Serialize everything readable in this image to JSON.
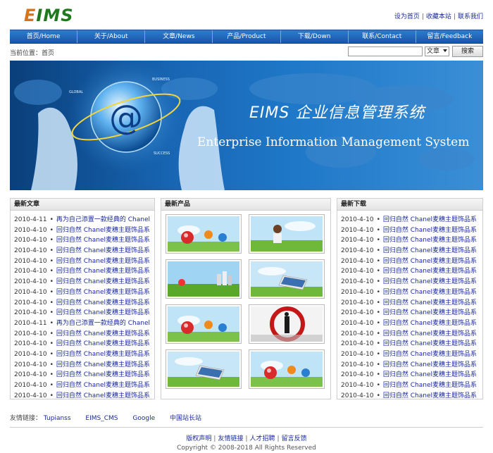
{
  "header": {
    "logo_e": "E",
    "logo_rest": "IMS",
    "top_links": [
      "设为首页",
      "收藏本站",
      "联系我们"
    ]
  },
  "nav": [
    "首页/Home",
    "关于/About",
    "文章/News",
    "产品/Product",
    "下载/Down",
    "联系/Contact",
    "留言/Feedback"
  ],
  "location": "当前位置：首页",
  "search": {
    "select_value": "文章",
    "button_label": "搜索",
    "input_value": ""
  },
  "banner": {
    "title": "EIMS   企业信息管理系统",
    "subtitle": "Enterprise Information Management System",
    "globe_labels": [
      "GLOBAL",
      "BUSINESS",
      "SUCCESS"
    ],
    "globe_symbol": "@"
  },
  "articles": {
    "heading": "最新文章",
    "items": [
      {
        "date": "2010-4-11",
        "title": "再为自己添置一款经典的 Chanel"
      },
      {
        "date": "2010-4-10",
        "title": "回归自然 Chanel麦穗主题饰品系"
      },
      {
        "date": "2010-4-10",
        "title": "回归自然 Chanel麦穗主题饰品系"
      },
      {
        "date": "2010-4-10",
        "title": "回归自然 Chanel麦穗主题饰品系"
      },
      {
        "date": "2010-4-10",
        "title": "回归自然 Chanel麦穗主题饰品系"
      },
      {
        "date": "2010-4-10",
        "title": "回归自然 Chanel麦穗主题饰品系"
      },
      {
        "date": "2010-4-10",
        "title": "回归自然 Chanel麦穗主题饰品系"
      },
      {
        "date": "2010-4-10",
        "title": "回归自然 Chanel麦穗主题饰品系"
      },
      {
        "date": "2010-4-10",
        "title": "回归自然 Chanel麦穗主题饰品系"
      },
      {
        "date": "2010-4-10",
        "title": "回归自然 Chanel麦穗主题饰品系"
      },
      {
        "date": "2010-4-11",
        "title": "再为自己添置一款经典的 Chanel"
      },
      {
        "date": "2010-4-10",
        "title": "回归自然 Chanel麦穗主题饰品系"
      },
      {
        "date": "2010-4-10",
        "title": "回归自然 Chanel麦穗主题饰品系"
      },
      {
        "date": "2010-4-10",
        "title": "回归自然 Chanel麦穗主题饰品系"
      },
      {
        "date": "2010-4-10",
        "title": "回归自然 Chanel麦穗主题饰品系"
      },
      {
        "date": "2010-4-10",
        "title": "回归自然 Chanel麦穗主题饰品系"
      },
      {
        "date": "2010-4-10",
        "title": "回归自然 Chanel麦穗主题饰品系"
      },
      {
        "date": "2010-4-10",
        "title": "回归自然 Chanel麦穗主题饰品系"
      }
    ]
  },
  "products": {
    "heading": "最新产品",
    "thumbs": [
      "balls",
      "girl",
      "landscape",
      "laptop",
      "balls",
      "businessman",
      "laptop",
      "balls"
    ]
  },
  "downloads": {
    "heading": "最新下载",
    "items": [
      {
        "date": "2010-4-10",
        "title": "回归自然 Chanel麦穗主题饰品系"
      },
      {
        "date": "2010-4-10",
        "title": "回归自然 Chanel麦穗主题饰品系"
      },
      {
        "date": "2010-4-10",
        "title": "回归自然 Chanel麦穗主题饰品系"
      },
      {
        "date": "2010-4-10",
        "title": "回归自然 Chanel麦穗主题饰品系"
      },
      {
        "date": "2010-4-10",
        "title": "回归自然 Chanel麦穗主题饰品系"
      },
      {
        "date": "2010-4-10",
        "title": "回归自然 Chanel麦穗主题饰品系"
      },
      {
        "date": "2010-4-10",
        "title": "回归自然 Chanel麦穗主题饰品系"
      },
      {
        "date": "2010-4-10",
        "title": "回归自然 Chanel麦穗主题饰品系"
      },
      {
        "date": "2010-4-10",
        "title": "回归自然 Chanel麦穗主题饰品系"
      },
      {
        "date": "2010-4-10",
        "title": "回归自然 Chanel麦穗主题饰品系"
      },
      {
        "date": "2010-4-10",
        "title": "回归自然 Chanel麦穗主题饰品系"
      },
      {
        "date": "2010-4-10",
        "title": "回归自然 Chanel麦穗主题饰品系"
      },
      {
        "date": "2010-4-10",
        "title": "回归自然 Chanel麦穗主题饰品系"
      },
      {
        "date": "2010-4-10",
        "title": "回归自然 Chanel麦穗主题饰品系"
      },
      {
        "date": "2010-4-10",
        "title": "回归自然 Chanel麦穗主题饰品系"
      },
      {
        "date": "2010-4-10",
        "title": "回归自然 Chanel麦穗主题饰品系"
      },
      {
        "date": "2010-4-10",
        "title": "回归自然 Chanel麦穗主题饰品系"
      },
      {
        "date": "2010-4-10",
        "title": "回归自然 Chanel麦穗主题饰品系"
      }
    ]
  },
  "friends": {
    "label": "友情链接：",
    "links": [
      "Tupianss",
      "EIMS_CMS",
      "Google",
      "中国站长站"
    ]
  },
  "footer": {
    "links": [
      "版权声明",
      "友情链接",
      "人才招聘",
      "留言反馈"
    ],
    "copyright": "Copyright © 2008-2018 All Rights Reserved"
  },
  "colors": {
    "nav_blue": "#1f6cc0",
    "link_blue": "#1a2a9a",
    "logo_orange": "#d9731a",
    "logo_green": "#1f7a1f"
  }
}
